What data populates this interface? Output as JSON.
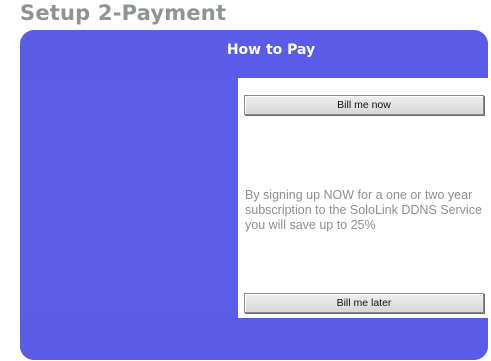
{
  "page": {
    "title": "Setup 2-Payment"
  },
  "panel": {
    "header": "How to Pay",
    "bill_now_label": "Bill me now",
    "promo_text": "By signing up NOW for a one or two year subscription to the SoloLink DDNS Service you will save up to 25%",
    "bill_later_label": "Bill me later"
  },
  "colors": {
    "panel_blue": "#5a5be6",
    "title_gray": "#8e9396",
    "text_gray": "#8a8f92"
  }
}
